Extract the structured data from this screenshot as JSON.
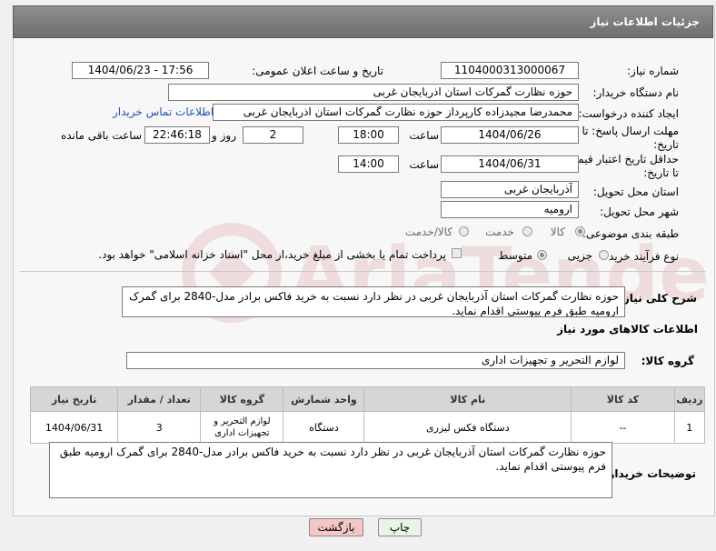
{
  "header": {
    "title": "جزئیات اطلاعات نیاز"
  },
  "form": {
    "need_number_label": "شماره نیاز:",
    "need_number": "1104000313000067",
    "announce_label": "تاریخ و ساعت اعلان عمومی:",
    "announce_value": "1404/06/23 - 17:56",
    "buyer_label": "نام دستگاه خریدار:",
    "buyer_value": "حوزه نظارت گمرکات استان اذربایجان غربی",
    "creator_label": "ایجاد کننده درخواست:",
    "creator_value": "محمدرضا مجیدزاده کارپرداز حوزه نظارت گمرکات استان اذربایجان غربی",
    "contact_link": "اطلاعات تماس خریدار",
    "reply_deadline_label_1": "مهلت ارسال پاسخ: تا",
    "reply_deadline_label_2": "تاریخ:",
    "reply_date": "1404/06/26",
    "time_label": "ساعت",
    "reply_time": "18:00",
    "days_value": "2",
    "days_label": "روز و",
    "remaining_value": "22:46:18",
    "remaining_label": "ساعت باقی مانده",
    "price_deadline_label_1": "حداقل تاریخ اعتبار قیمت:",
    "price_deadline_label_2": "تا تاریخ:",
    "price_date": "1404/06/31",
    "price_time": "14:00",
    "province_label": "استان محل تحویل:",
    "province_value": "آذربایجان غربی",
    "city_label": "شهر محل تحویل:",
    "city_value": "ارومیه",
    "category_label": "طبقه بندی موضوعی:",
    "category_options": [
      "کالا",
      "خدمت",
      "کالا/خدمت"
    ],
    "process_label": "نوع فرآیند خرید :",
    "process_options": [
      "جزیی",
      "متوسط"
    ],
    "payment_note": "پرداخت تمام یا بخشی از مبلغ خرید،از محل \"اسناد خزانه اسلامی\" خواهد بود."
  },
  "description": {
    "label": "شرح کلی نیاز:",
    "text": "حوزه نظارت گمرکات استان آذربایجان غربی در نظر دارد نسبت به خرید فاکس برادر مدل-2840 برای گمرک ارومیه طبق فرم پیوستی اقدام نماید."
  },
  "goods_section": {
    "title": "اطلاعات کالاهای مورد نیاز",
    "group_label": "گروه کالا:",
    "group_value": "لوازم التحریر و تجهیزات اداری"
  },
  "table": {
    "headers": [
      "ردیف",
      "کد کالا",
      "نام کالا",
      "واحد شمارش",
      "گروه کالا",
      "تعداد / مقدار",
      "تاریخ نیاز"
    ],
    "rows": [
      [
        "1",
        "--",
        "دستگاه فکس لیزری",
        "دستگاه",
        "لوازم التحریر و تجهیزات اداری",
        "3",
        "1404/06/31"
      ]
    ]
  },
  "buyer_notes": {
    "label": "توضیحات خریدار:",
    "text": "حوزه نظارت گمرکات استان آذربایجان غربی در نظر دارد نسبت به خرید فاکس برادر مدل-2840 برای گمرک ارومیه طبق فرم پیوستی اقدام نماید."
  },
  "buttons": {
    "print": "چاپ",
    "back": "بازگشت"
  },
  "colors": {
    "header_bg": "#7d7d7d",
    "link": "#1a56b8",
    "back_btn_bg": "#f5c6c6",
    "print_btn_bg": "#e9f5e4"
  }
}
